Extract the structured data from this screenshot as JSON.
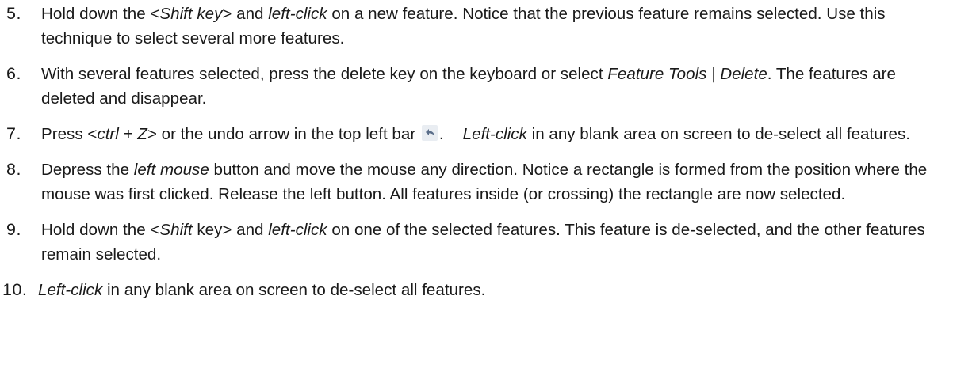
{
  "steps": [
    {
      "number": "5.",
      "parts": {
        "a": "Hold down the <",
        "b": "Shift key",
        "c": "> and ",
        "d": "left-click",
        "e": " on a new feature.  Notice that the previous feature remains selected.  Use this technique to select several more features."
      }
    },
    {
      "number": "6.",
      "parts": {
        "a": "With several features selected, press the delete key on the keyboard or select ",
        "b": "Feature Tools | Delete",
        "c": ". The features are deleted and disappear."
      }
    },
    {
      "number": "7.",
      "parts": {
        "a": "Press <",
        "b": "ctrl + Z",
        "c": "> or the undo arrow in the top left bar ",
        "d": ".",
        "e": "Left-click",
        "f": " in any blank area on screen to de-select all features."
      },
      "icon": "undo-arrow-icon"
    },
    {
      "number": "8.",
      "parts": {
        "a": "Depress the ",
        "b": "left mouse",
        "c": " button and move the mouse any direction. Notice a rectangle is formed from the position where the mouse was first clicked.  Release the left button. All features inside (or crossing) the rectangle are now selected."
      }
    },
    {
      "number": "9.",
      "parts": {
        "a": "Hold down the <",
        "b": "Shift",
        "c": " key> and ",
        "d": "left-click",
        "e": " on one of the selected features. This feature is de-selected, and the other features remain selected."
      }
    },
    {
      "number": "10.",
      "parts": {
        "a": "Left-click",
        "b": " in any blank area on screen to de-select all features."
      }
    }
  ],
  "colors": {
    "text": "#1a1a1a",
    "icon_fill": "#5b6e8a",
    "icon_bg": "#e9edf2"
  }
}
